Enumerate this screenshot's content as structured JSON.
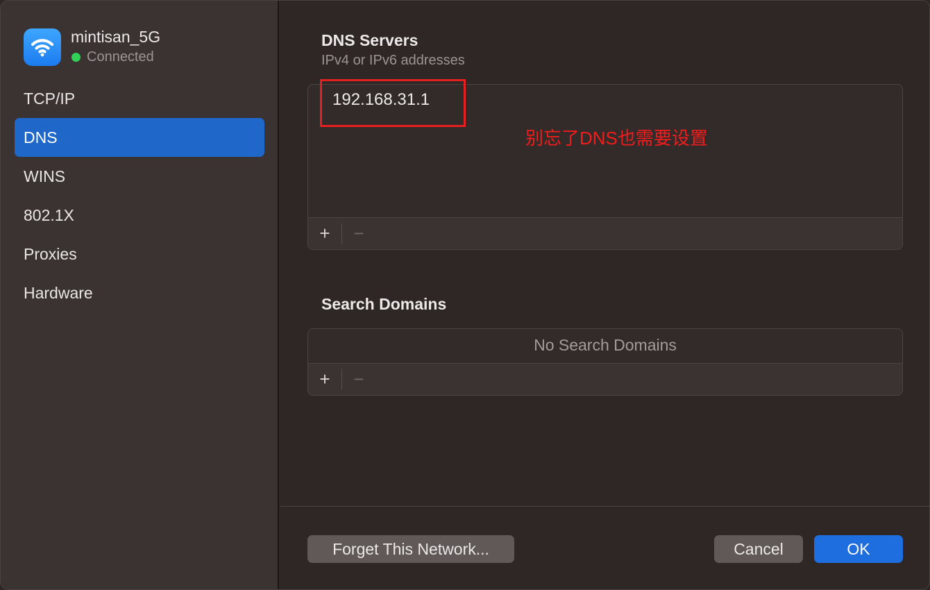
{
  "network": {
    "name": "mintisan_5G",
    "status": "Connected",
    "icon": "wifi-icon",
    "status_color": "#31d158"
  },
  "sidebar": {
    "items": [
      {
        "label": "TCP/IP",
        "active": false
      },
      {
        "label": "DNS",
        "active": true
      },
      {
        "label": "WINS",
        "active": false
      },
      {
        "label": "802.1X",
        "active": false
      },
      {
        "label": "Proxies",
        "active": false
      },
      {
        "label": "Hardware",
        "active": false
      }
    ]
  },
  "dns_servers": {
    "title": "DNS Servers",
    "subtitle": "IPv4 or IPv6 addresses",
    "entries": [
      "192.168.31.1"
    ],
    "add_label": "+",
    "remove_label": "−"
  },
  "annotation": {
    "text": "别忘了DNS也需要设置",
    "color": "#f21c1c"
  },
  "search_domains": {
    "title": "Search Domains",
    "empty_text": "No Search Domains",
    "add_label": "+",
    "remove_label": "−"
  },
  "buttons": {
    "forget": "Forget This Network...",
    "cancel": "Cancel",
    "ok": "OK"
  },
  "colors": {
    "accent": "#1f67c9",
    "ok_button": "#1f6ee0",
    "highlight": "#e62020"
  }
}
